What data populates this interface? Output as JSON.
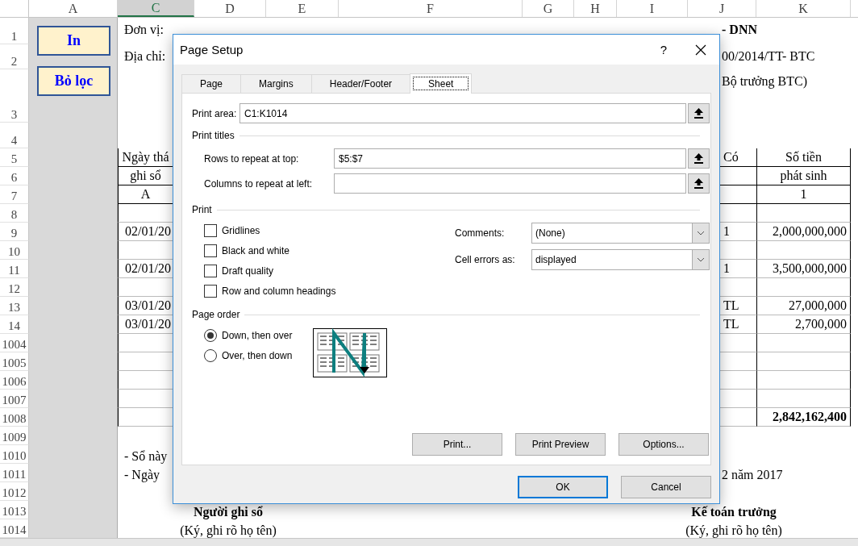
{
  "sheet": {
    "columns": [
      {
        "label": "A",
        "selected": false
      },
      {
        "label": "C",
        "selected": true
      },
      {
        "label": "D",
        "selected": false
      },
      {
        "label": "E",
        "selected": false
      },
      {
        "label": "F",
        "selected": false
      },
      {
        "label": "G",
        "selected": false
      },
      {
        "label": "H",
        "selected": false
      },
      {
        "label": "I",
        "selected": false
      },
      {
        "label": "J",
        "selected": false
      },
      {
        "label": "K",
        "selected": false
      }
    ],
    "shape_buttons": [
      {
        "label": "In"
      },
      {
        "label": "Bỏ lọc"
      }
    ],
    "rows": [
      {
        "label": "1",
        "kind": "title",
        "cells": {
          "c": {
            "text": "Đơn vị:"
          },
          "jk": {
            "text": "- DNN",
            "bold": true
          }
        }
      },
      {
        "label": "2",
        "kind": "title",
        "cells": {
          "c": {
            "text": "Địa chỉ:"
          },
          "jk": {
            "text": "00/2014/TT- BTC"
          }
        }
      },
      {
        "label": "3",
        "kind": "title",
        "cells": {
          "jk": {
            "text": "Bộ trưởng BTC)"
          }
        }
      },
      {
        "label": "4",
        "kind": "title",
        "cells": {}
      },
      {
        "label": "5",
        "kind": "head",
        "cells": {
          "c": {
            "text": "Ngày thá"
          },
          "j": {
            "text": "Có"
          },
          "k": {
            "text": "Số tiền"
          }
        }
      },
      {
        "label": "6",
        "kind": "head",
        "cells": {
          "c": {
            "text": "ghi sổ"
          },
          "k": {
            "text": "phát sinh"
          }
        }
      },
      {
        "label": "7",
        "kind": "head",
        "cells": {
          "c": {
            "text": "A"
          },
          "k": {
            "text": "1"
          }
        }
      },
      {
        "label": "8",
        "kind": "table",
        "cells": {}
      },
      {
        "label": "9",
        "kind": "table",
        "cells": {
          "c": {
            "text": "02/01/20"
          },
          "j": {
            "text": "1"
          },
          "k": {
            "text": "2,000,000,000"
          }
        }
      },
      {
        "label": "10",
        "kind": "table",
        "cells": {}
      },
      {
        "label": "11",
        "kind": "table",
        "cells": {
          "c": {
            "text": "02/01/20"
          },
          "j": {
            "text": "1"
          },
          "k": {
            "text": "3,500,000,000"
          }
        }
      },
      {
        "label": "12",
        "kind": "table",
        "cells": {}
      },
      {
        "label": "13",
        "kind": "table",
        "cells": {
          "c": {
            "text": "03/01/20"
          },
          "j": {
            "text": "TL"
          },
          "k": {
            "text": "27,000,000"
          }
        }
      },
      {
        "label": "14",
        "kind": "table",
        "cells": {
          "c": {
            "text": "03/01/20"
          },
          "j": {
            "text": "TL"
          },
          "k": {
            "text": "2,700,000"
          }
        }
      },
      {
        "label": "1004",
        "kind": "table",
        "cells": {}
      },
      {
        "label": "1005",
        "kind": "table",
        "cells": {}
      },
      {
        "label": "1006",
        "kind": "table",
        "cells": {}
      },
      {
        "label": "1007",
        "kind": "table",
        "cells": {}
      },
      {
        "label": "1008",
        "kind": "table",
        "cells": {
          "k": {
            "text": "2,842,162,400",
            "bold": true
          }
        }
      },
      {
        "label": "1009",
        "kind": "note",
        "cells": {}
      },
      {
        "label": "1010",
        "kind": "note",
        "cells": {
          "c": {
            "text": "- Sổ này"
          }
        }
      },
      {
        "label": "1011",
        "kind": "note",
        "cells": {
          "c": {
            "text": "- Ngày"
          },
          "jk": {
            "text": "2 năm 2017"
          }
        }
      },
      {
        "label": "1012",
        "kind": "note",
        "cells": {}
      },
      {
        "label": "1013",
        "kind": "note",
        "cells": {
          "ce": {
            "text": "Người ghi sổ",
            "bold": true
          },
          "ik": {
            "text": "Kế toán trưởng",
            "bold": true
          }
        }
      },
      {
        "label": "1014",
        "kind": "note",
        "cells": {
          "ce": {
            "text": "(Ký, ghi rõ họ tên)"
          },
          "ik": {
            "text": "(Ký, ghi rõ họ tên)"
          }
        }
      }
    ]
  },
  "dialog": {
    "title": "Page Setup",
    "help": "?",
    "tabs": [
      {
        "label": "Page",
        "selected": false
      },
      {
        "label": "Margins",
        "selected": false
      },
      {
        "label": "Header/Footer",
        "selected": false
      },
      {
        "label": "Sheet",
        "selected": true
      }
    ],
    "print_area": {
      "label": "Print area:",
      "value": "C1:K1014"
    },
    "print_titles": {
      "heading": "Print titles",
      "fields": [
        {
          "label": "Rows to repeat at top:",
          "value": "$5:$7"
        },
        {
          "label": "Columns to repeat at left:"
        }
      ]
    },
    "print": {
      "heading": "Print",
      "checkboxes": [
        {
          "label": "Gridlines",
          "checked": false
        },
        {
          "label": "Black and white",
          "checked": false
        },
        {
          "label": "Draft quality",
          "checked": false
        },
        {
          "label": "Row and column headings",
          "checked": false
        }
      ],
      "selects": [
        {
          "label": "Comments:",
          "value": "(None)"
        },
        {
          "label": "Cell errors as:",
          "value": "displayed"
        }
      ]
    },
    "page_order": {
      "heading": "Page order",
      "options": [
        {
          "label": "Down, then over",
          "selected": true
        },
        {
          "label": "Over, then down",
          "selected": false
        }
      ]
    },
    "panel_buttons": [
      "Print...",
      "Print Preview",
      "Options..."
    ],
    "footer_buttons": [
      {
        "label": "OK",
        "default": true
      },
      {
        "label": "Cancel",
        "default": false
      }
    ]
  }
}
